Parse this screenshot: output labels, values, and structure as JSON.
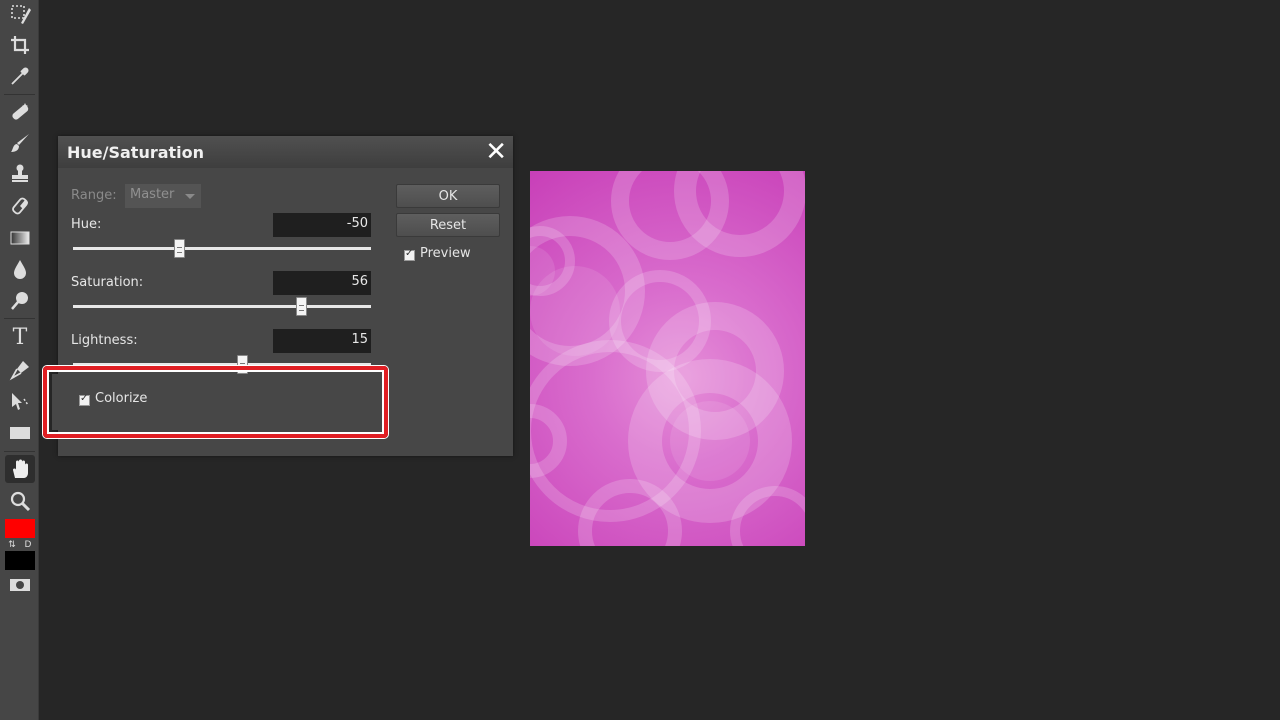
{
  "toolbar": {
    "tools": [
      {
        "name": "lasso-select-tool-icon"
      },
      {
        "name": "crop-tool-icon"
      },
      {
        "name": "eyedropper-tool-icon"
      },
      {
        "name": "healing-tool-icon"
      },
      {
        "name": "brush-tool-icon"
      },
      {
        "name": "clone-stamp-tool-icon"
      },
      {
        "name": "eraser-tool-icon"
      },
      {
        "name": "gradient-tool-icon"
      },
      {
        "name": "blur-drop-tool-icon"
      },
      {
        "name": "dodge-tool-icon"
      },
      {
        "name": "type-tool-icon"
      },
      {
        "name": "pen-tool-icon"
      },
      {
        "name": "path-select-tool-icon"
      },
      {
        "name": "rectangle-tool-icon"
      },
      {
        "name": "hand-tool-icon",
        "active": true
      },
      {
        "name": "zoom-tool-icon"
      }
    ],
    "type_tool_glyph": "T",
    "foreground_color": "#ff0000",
    "background_color": "#000000",
    "swap_glyph": "⇅",
    "default_glyph": "D"
  },
  "dialog": {
    "title": "Hue/Saturation",
    "close_glyph": "✕",
    "range": {
      "label": "Range:",
      "value": "Master"
    },
    "hue": {
      "label": "Hue:",
      "value": "-50",
      "level": 0.36
    },
    "saturation": {
      "label": "Saturation:",
      "value": "56",
      "level": 0.77
    },
    "lightness": {
      "label": "Lightness:",
      "value": "15",
      "level": 0.57
    },
    "ok_label": "OK",
    "reset_label": "Reset",
    "preview": {
      "label": "Preview",
      "checked": true
    },
    "colorize": {
      "label": "Colorize",
      "checked": true
    }
  },
  "colors": {
    "highlight": "#e01f24",
    "image_base": "#c83fb8"
  }
}
